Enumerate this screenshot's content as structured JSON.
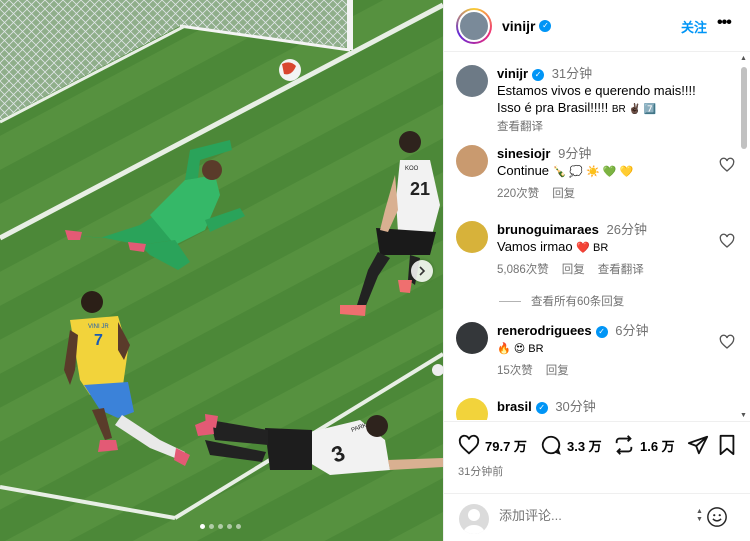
{
  "header": {
    "username": "vinijr",
    "follow_label": "关注",
    "more_label": "•••"
  },
  "caption": {
    "username": "vinijr",
    "time": "31分钟",
    "line1": "Estamos vivos e querendo mais!!!!",
    "line2": "Isso é pra Brasil!!!!!",
    "line2_suffix": "BR ✌🏿 7️⃣",
    "translate_label": "查看翻译"
  },
  "comments": [
    {
      "username": "sinesiojr",
      "time": "9分钟",
      "text": "Continue",
      "emojis": "🍾 💭 ☀️ 💚 💛",
      "likes": "220次赞",
      "reply": "回复",
      "translate": ""
    },
    {
      "username": "brunoguimaraes",
      "time": "26分钟",
      "text": "Vamos irmao",
      "emojis": "❤️ BR",
      "likes": "5,086次赞",
      "reply": "回复",
      "translate": "查看翻译"
    },
    {
      "username": "renerodriguees",
      "time": "6分钟",
      "text": "",
      "emojis": "🔥 😍 BR",
      "likes": "15次赞",
      "reply": "回复",
      "translate": ""
    },
    {
      "username": "brasil",
      "time": "30分钟",
      "text": "",
      "emojis": "",
      "likes": "",
      "reply": "",
      "translate": ""
    }
  ],
  "view_all_replies": "查看所有60条回复",
  "actions": {
    "likes": "79.7 万",
    "comments": "3.3 万",
    "reposts": "1.6 万"
  },
  "posted_ago": "31分钟前",
  "composer": {
    "placeholder": "添加评论..."
  },
  "photo": {
    "carousel_count": 5,
    "active_index": 0,
    "player_jersey_1": "VINI JR",
    "player_number_1": "7",
    "player_number_2": "21",
    "player_name_2": "KOO",
    "player_number_3": "3",
    "player_name_3": "PARK"
  },
  "colors": {
    "accent": "#0095f6",
    "pitch": "#4f8a3a",
    "keeper_kit": "#2aa35a",
    "brazil_yellow": "#f2d33b"
  }
}
